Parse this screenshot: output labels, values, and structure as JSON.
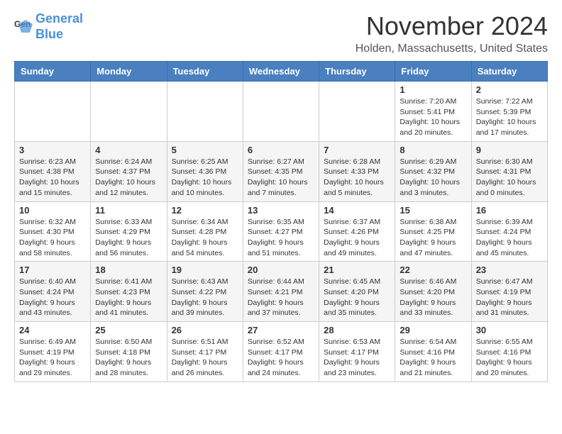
{
  "header": {
    "logo_line1": "General",
    "logo_line2": "Blue",
    "month_title": "November 2024",
    "location": "Holden, Massachusetts, United States"
  },
  "weekdays": [
    "Sunday",
    "Monday",
    "Tuesday",
    "Wednesday",
    "Thursday",
    "Friday",
    "Saturday"
  ],
  "weeks": [
    [
      {
        "day": "",
        "info": ""
      },
      {
        "day": "",
        "info": ""
      },
      {
        "day": "",
        "info": ""
      },
      {
        "day": "",
        "info": ""
      },
      {
        "day": "",
        "info": ""
      },
      {
        "day": "1",
        "info": "Sunrise: 7:20 AM\nSunset: 5:41 PM\nDaylight: 10 hours and 20 minutes."
      },
      {
        "day": "2",
        "info": "Sunrise: 7:22 AM\nSunset: 5:39 PM\nDaylight: 10 hours and 17 minutes."
      }
    ],
    [
      {
        "day": "3",
        "info": "Sunrise: 6:23 AM\nSunset: 4:38 PM\nDaylight: 10 hours and 15 minutes."
      },
      {
        "day": "4",
        "info": "Sunrise: 6:24 AM\nSunset: 4:37 PM\nDaylight: 10 hours and 12 minutes."
      },
      {
        "day": "5",
        "info": "Sunrise: 6:25 AM\nSunset: 4:36 PM\nDaylight: 10 hours and 10 minutes."
      },
      {
        "day": "6",
        "info": "Sunrise: 6:27 AM\nSunset: 4:35 PM\nDaylight: 10 hours and 7 minutes."
      },
      {
        "day": "7",
        "info": "Sunrise: 6:28 AM\nSunset: 4:33 PM\nDaylight: 10 hours and 5 minutes."
      },
      {
        "day": "8",
        "info": "Sunrise: 6:29 AM\nSunset: 4:32 PM\nDaylight: 10 hours and 3 minutes."
      },
      {
        "day": "9",
        "info": "Sunrise: 6:30 AM\nSunset: 4:31 PM\nDaylight: 10 hours and 0 minutes."
      }
    ],
    [
      {
        "day": "10",
        "info": "Sunrise: 6:32 AM\nSunset: 4:30 PM\nDaylight: 9 hours and 58 minutes."
      },
      {
        "day": "11",
        "info": "Sunrise: 6:33 AM\nSunset: 4:29 PM\nDaylight: 9 hours and 56 minutes."
      },
      {
        "day": "12",
        "info": "Sunrise: 6:34 AM\nSunset: 4:28 PM\nDaylight: 9 hours and 54 minutes."
      },
      {
        "day": "13",
        "info": "Sunrise: 6:35 AM\nSunset: 4:27 PM\nDaylight: 9 hours and 51 minutes."
      },
      {
        "day": "14",
        "info": "Sunrise: 6:37 AM\nSunset: 4:26 PM\nDaylight: 9 hours and 49 minutes."
      },
      {
        "day": "15",
        "info": "Sunrise: 6:38 AM\nSunset: 4:25 PM\nDaylight: 9 hours and 47 minutes."
      },
      {
        "day": "16",
        "info": "Sunrise: 6:39 AM\nSunset: 4:24 PM\nDaylight: 9 hours and 45 minutes."
      }
    ],
    [
      {
        "day": "17",
        "info": "Sunrise: 6:40 AM\nSunset: 4:24 PM\nDaylight: 9 hours and 43 minutes."
      },
      {
        "day": "18",
        "info": "Sunrise: 6:41 AM\nSunset: 4:23 PM\nDaylight: 9 hours and 41 minutes."
      },
      {
        "day": "19",
        "info": "Sunrise: 6:43 AM\nSunset: 4:22 PM\nDaylight: 9 hours and 39 minutes."
      },
      {
        "day": "20",
        "info": "Sunrise: 6:44 AM\nSunset: 4:21 PM\nDaylight: 9 hours and 37 minutes."
      },
      {
        "day": "21",
        "info": "Sunrise: 6:45 AM\nSunset: 4:20 PM\nDaylight: 9 hours and 35 minutes."
      },
      {
        "day": "22",
        "info": "Sunrise: 6:46 AM\nSunset: 4:20 PM\nDaylight: 9 hours and 33 minutes."
      },
      {
        "day": "23",
        "info": "Sunrise: 6:47 AM\nSunset: 4:19 PM\nDaylight: 9 hours and 31 minutes."
      }
    ],
    [
      {
        "day": "24",
        "info": "Sunrise: 6:49 AM\nSunset: 4:19 PM\nDaylight: 9 hours and 29 minutes."
      },
      {
        "day": "25",
        "info": "Sunrise: 6:50 AM\nSunset: 4:18 PM\nDaylight: 9 hours and 28 minutes."
      },
      {
        "day": "26",
        "info": "Sunrise: 6:51 AM\nSunset: 4:17 PM\nDaylight: 9 hours and 26 minutes."
      },
      {
        "day": "27",
        "info": "Sunrise: 6:52 AM\nSunset: 4:17 PM\nDaylight: 9 hours and 24 minutes."
      },
      {
        "day": "28",
        "info": "Sunrise: 6:53 AM\nSunset: 4:17 PM\nDaylight: 9 hours and 23 minutes."
      },
      {
        "day": "29",
        "info": "Sunrise: 6:54 AM\nSunset: 4:16 PM\nDaylight: 9 hours and 21 minutes."
      },
      {
        "day": "30",
        "info": "Sunrise: 6:55 AM\nSunset: 4:16 PM\nDaylight: 9 hours and 20 minutes."
      }
    ]
  ]
}
